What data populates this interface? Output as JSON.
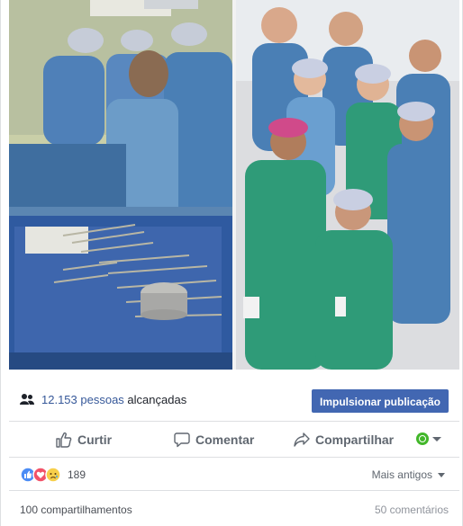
{
  "post": {
    "photos": [
      {
        "name": "operating-room-photo"
      },
      {
        "name": "surgical-team-group-photo"
      }
    ],
    "reach": {
      "count": "12.153 pessoas",
      "suffix": "alcançadas",
      "boost_label": "Impulsionar publicação"
    },
    "actions": {
      "like_label": "Curtir",
      "comment_label": "Comentar",
      "share_label": "Compartilhar"
    },
    "reactions": {
      "icons": [
        "like-reaction-icon",
        "love-reaction-icon",
        "sad-reaction-icon"
      ],
      "count": "189",
      "sort_label": "Mais antigos"
    },
    "stats": {
      "shares": "100 compartilhamentos",
      "comments": "50 comentários"
    }
  },
  "colors": {
    "accent": "#4267b2",
    "link": "#365899",
    "scrub_blue": "#4a7fb5",
    "scrub_green": "#2f9b78"
  }
}
